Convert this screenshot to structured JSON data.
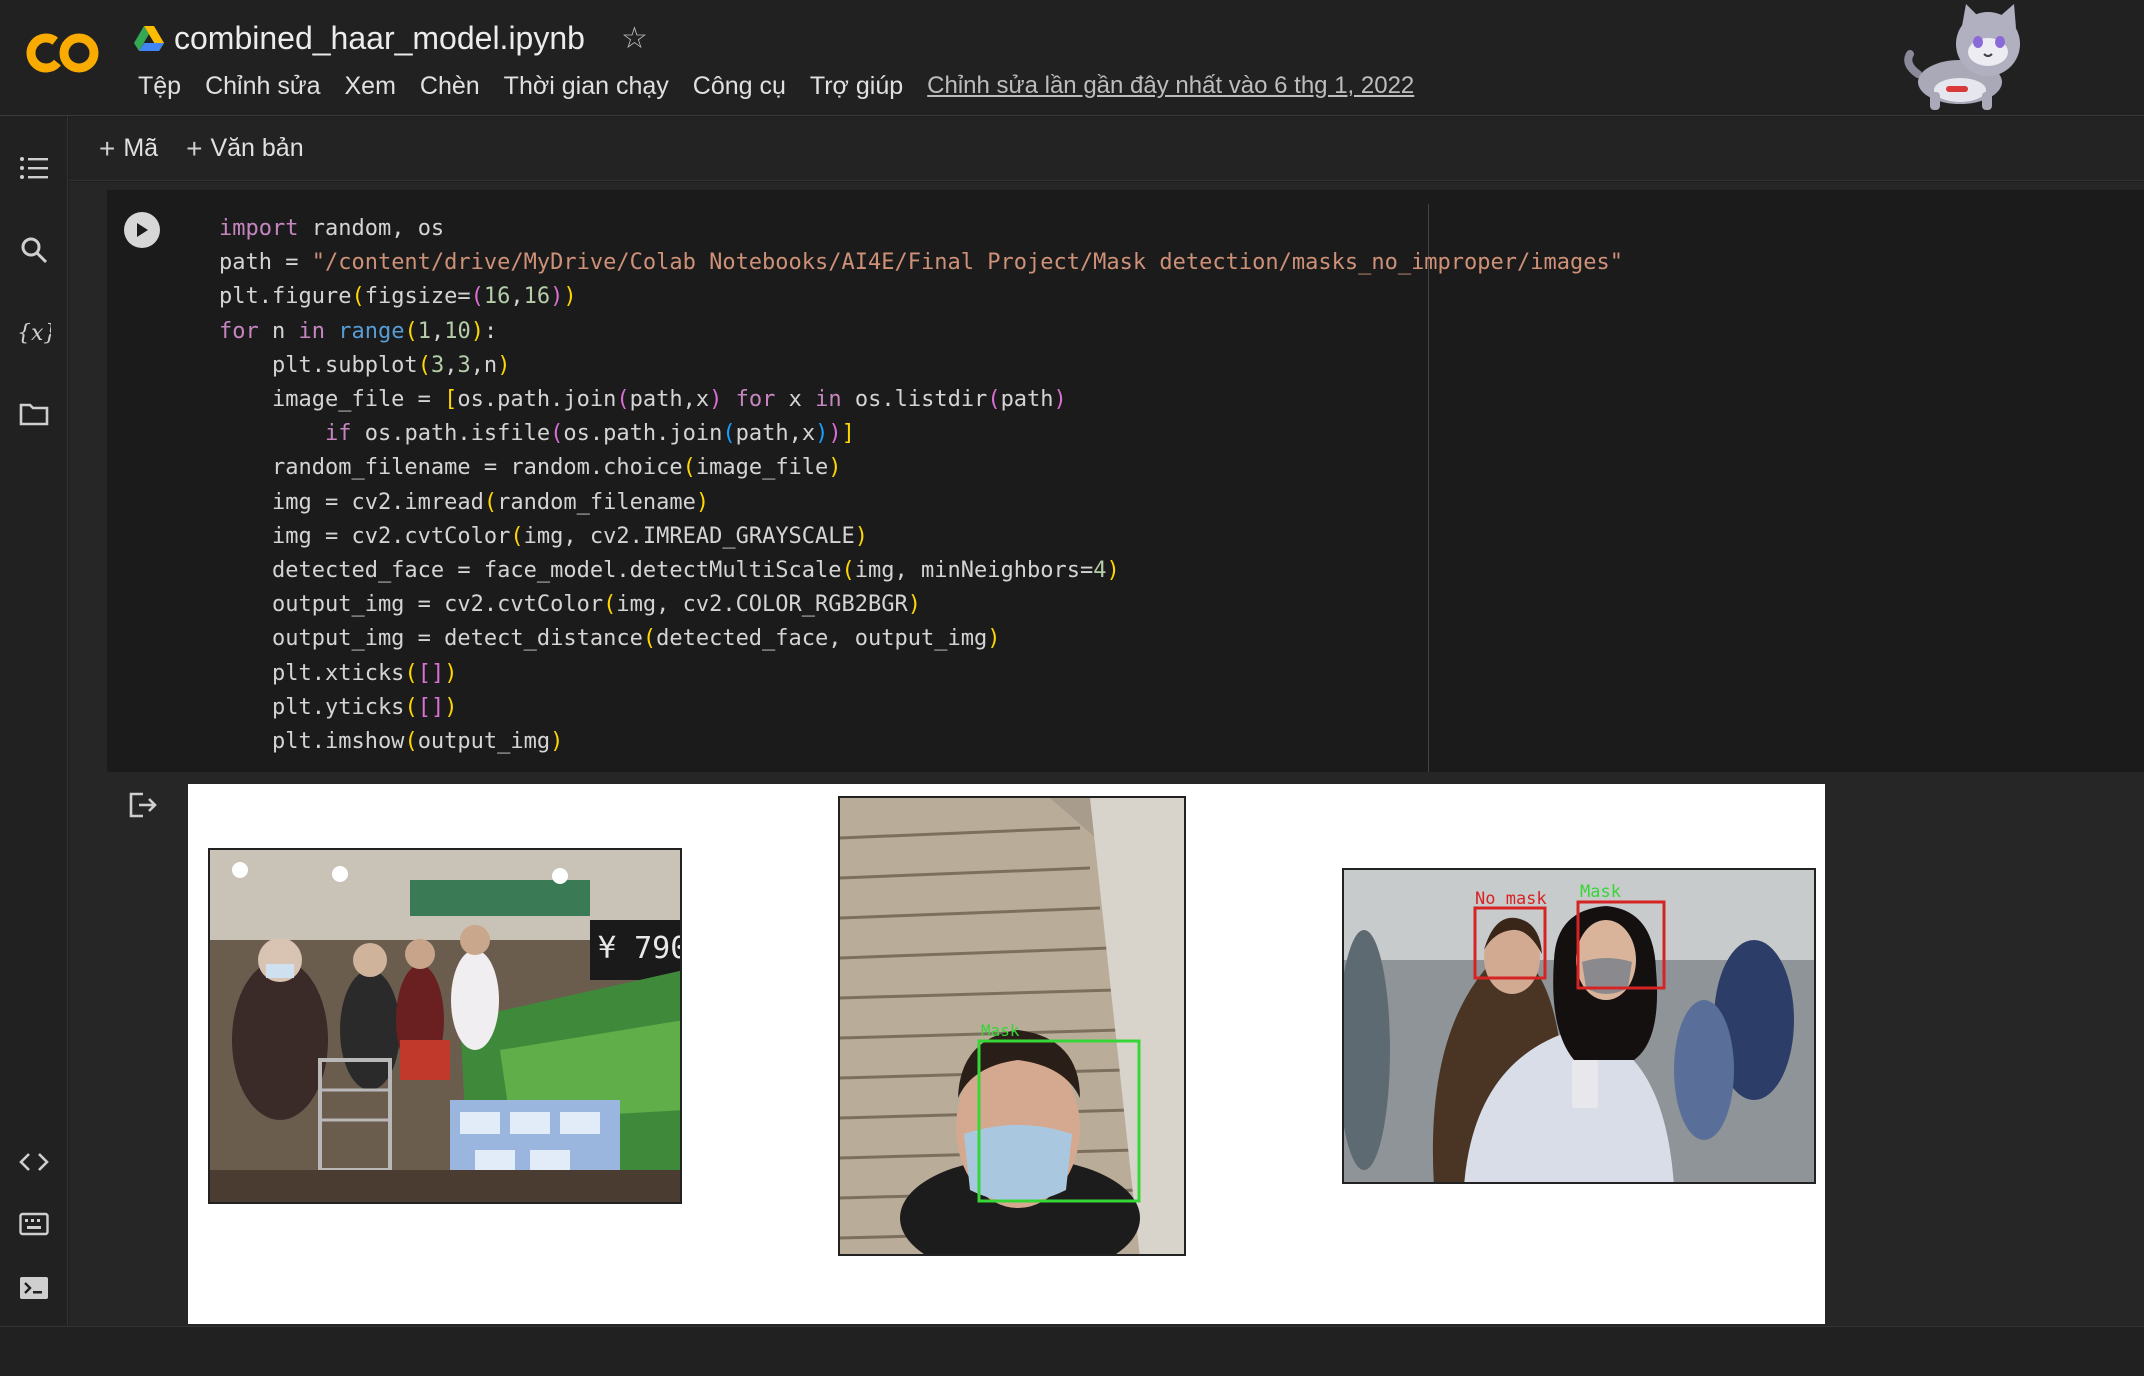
{
  "app": {
    "notebook_title": "combined_haar_model.ipynb",
    "menu": [
      "Tệp",
      "Chỉnh sửa",
      "Xem",
      "Chèn",
      "Thời gian chạy",
      "Công cụ",
      "Trợ giúp"
    ],
    "last_edit": "Chỉnh sửa lần gần đây nhất vào 6 thg 1, 2022"
  },
  "toolbar": {
    "add_code": "Mã",
    "add_text": "Văn bản"
  },
  "cell": {
    "code_lines": [
      "import random, os",
      "path = \"/content/drive/MyDrive/Colab Notebooks/AI4E/Final Project/Mask detection/masks_no_improper/images\"",
      "plt.figure(figsize=(16,16))",
      "for n in range(1,10):",
      "    plt.subplot(3,3,n)",
      "    image_file = [os.path.join(path,x) for x in os.listdir(path)",
      "        if os.path.isfile(os.path.join(path,x))]",
      "    random_filename = random.choice(image_file)",
      "    img = cv2.imread(random_filename)",
      "    img = cv2.cvtColor(img, cv2.IMREAD_GRAYSCALE)",
      "    detected_face = face_model.detectMultiScale(img, minNeighbors=4)",
      "    output_img = cv2.cvtColor(img, cv2.COLOR_RGB2BGR)",
      "    output_img = detect_distance(detected_face, output_img)",
      "    plt.xticks([])",
      "    plt.yticks([])",
      "    plt.imshow(output_img)"
    ]
  },
  "output": {
    "plots": [
      {
        "scene": "supermarket shoppers"
      },
      {
        "scene": "man against brick wall",
        "labels": [
          "Mask"
        ]
      },
      {
        "scene": "two women in crowd",
        "labels": [
          "No mask",
          "Mask"
        ]
      }
    ]
  },
  "colors": {
    "mask_box": "#37d637",
    "no_mask_box": "#d62424"
  }
}
